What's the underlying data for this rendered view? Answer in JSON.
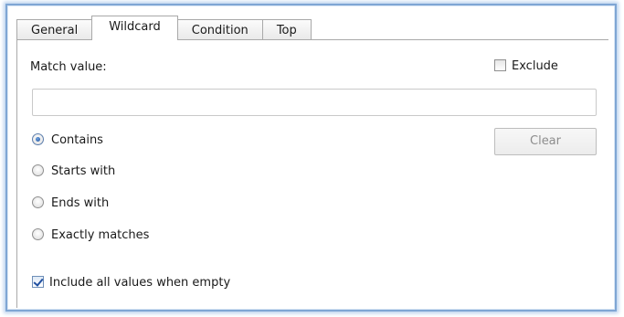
{
  "tabs": [
    {
      "label": "General"
    },
    {
      "label": "Wildcard"
    },
    {
      "label": "Condition"
    },
    {
      "label": "Top"
    }
  ],
  "active_tab": "Wildcard",
  "match_value": {
    "label": "Match value:",
    "value": ""
  },
  "exclude": {
    "label": "Exclude",
    "checked": false
  },
  "match_modes": [
    {
      "label": "Contains",
      "selected": true
    },
    {
      "label": "Starts with",
      "selected": false
    },
    {
      "label": "Ends with",
      "selected": false
    },
    {
      "label": "Exactly matches",
      "selected": false
    }
  ],
  "clear_button": {
    "label": "Clear",
    "enabled": false
  },
  "include_all": {
    "label": "Include all values when empty",
    "checked": true
  },
  "colors": {
    "frame_border": "#7fa6d4",
    "radio_selected": "#1c4f9a",
    "disabled_text": "#8d8d8d"
  }
}
